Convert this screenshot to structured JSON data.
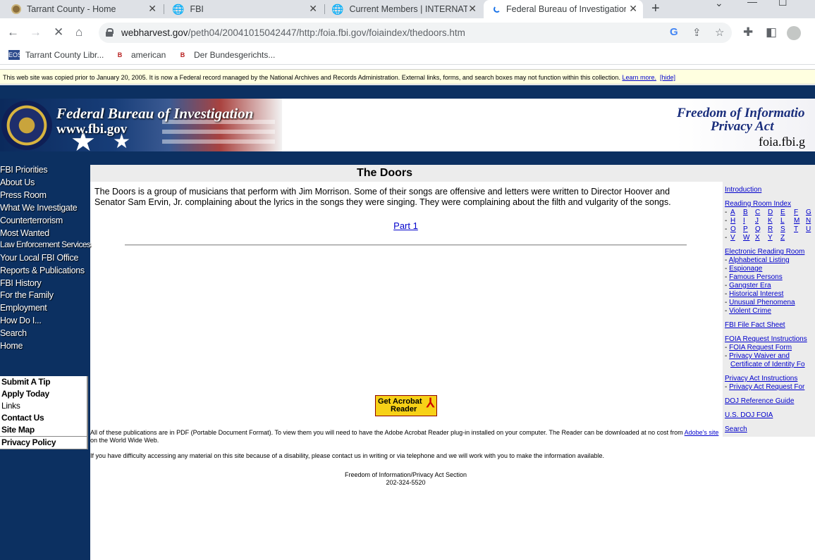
{
  "browser": {
    "tabs": [
      {
        "title": "Tarrant County - Home",
        "icon": "tarrant-favicon"
      },
      {
        "title": "FBI",
        "icon": "globe-icon"
      },
      {
        "title": "Current Members | INTERNATI",
        "icon": "globe-icon"
      },
      {
        "title": "Federal Bureau of Investigation",
        "icon": "loading-spinner"
      }
    ],
    "new_tab": "+",
    "url_domain": "webharvest.gov",
    "url_path": "/peth04/20041015042447/http:/foia.fbi.gov/foiaindex/thedoors.htm",
    "bookmarks": [
      "Tarrant County Libr...",
      "american",
      "Der Bundesgerichts..."
    ]
  },
  "notice": {
    "text": "This web site was copied prior to January 20, 2005. It is now a Federal record managed by the National Archives and Records Administration. External links, forms, and search boxes may not function within this collection.",
    "learn_more": "Learn more.",
    "hide": "[hide]"
  },
  "header": {
    "agency": "Federal Bureau of Investigation",
    "site": "www.fbi.gov",
    "foia_line1": "Freedom of Informatio",
    "foia_line2": "Privacy Act",
    "foia_site": "foia.fbi.g"
  },
  "leftnav": {
    "items": [
      "FBI Priorities",
      "About Us",
      "Press Room",
      "What We Investigate",
      "Counterterrorism",
      "Most Wanted",
      "Law Enforcement Services",
      "Your Local FBI Office",
      "Reports & Publications",
      "FBI History",
      "For the Family",
      "Employment",
      "How Do I...",
      "Search",
      "Home"
    ],
    "buttons": [
      "Submit A Tip",
      "Apply Today",
      "Links",
      "Contact Us",
      "Site Map",
      "Privacy Policy"
    ]
  },
  "main": {
    "title": "The Doors",
    "description": "The Doors is a group of musicians that perform with Jim Morrison. Some of their songs are offensive and letters were written to Director Hoover and Senator Sam Ervin, Jr. complaining about the lyrics in the songs they were singing. They were complaining about the filth and vulgarity of the songs.",
    "part1": "Part 1",
    "acrobat_line1": "Get Acrobat",
    "acrobat_line2": "Reader",
    "pdf_note_before": "All of these publications are in PDF (Portable Document Format). To view them you will need to have the Adobe Acrobat Reader plug-in installed on your computer. The Reader can be downloaded at no cost from",
    "adobe_link": "Adobe's site",
    "pdf_note_after": "on the World Wide Web.",
    "access": "If you have difficulty accessing any material on this site because of a disability, please contact us in writing or via telephone and we will work with you to make the information available.",
    "footer_line1": "Freedom of Information/Privacy Act Section",
    "footer_line2": "202-324-5520"
  },
  "rightnav": {
    "introduction": "Introduction",
    "reading_room_index": "Reading Room Index",
    "letters_row1": [
      "A",
      "B",
      "C",
      "D",
      "E",
      "F",
      "G"
    ],
    "letters_row2": [
      "H",
      "I",
      "J",
      "K",
      "L",
      "M",
      "N"
    ],
    "letters_row3": [
      "O",
      "P",
      "Q",
      "R",
      "S",
      "T",
      "U"
    ],
    "letters_row4": [
      "V",
      "W",
      "X",
      "Y",
      "Z"
    ],
    "electronic_reading_room": "Electronic Reading Room",
    "err_items": [
      "Alphabetical Listing",
      "Espionage",
      "Famous Persons",
      "Gangster Era",
      "Historical Interest",
      "Unusual Phenomena",
      "Violent Crime"
    ],
    "fact_sheet": "FBI File Fact Sheet",
    "foia_instructions": "FOIA Request Instructions",
    "foia_items": [
      "FOIA Request Form",
      "Privacy Waiver and",
      "Certificate of Identity Fo"
    ],
    "privacy_instructions": "Privacy Act Instructions",
    "privacy_items": [
      "Privacy Act Request For"
    ],
    "doj_guide": "DOJ Reference Guide",
    "doj_foia": "U.S. DOJ FOIA",
    "search": "Search"
  }
}
